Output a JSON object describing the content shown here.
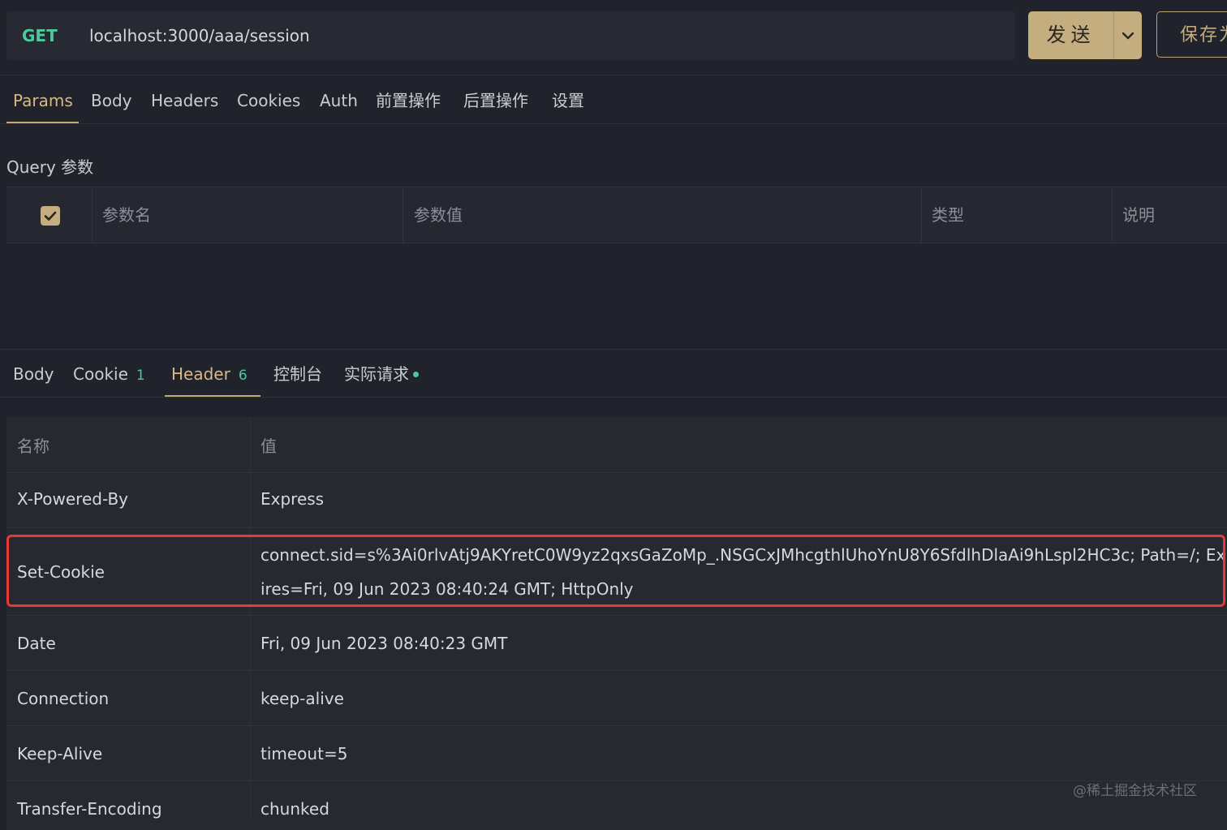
{
  "request": {
    "method": "GET",
    "url": "localhost:3000/aaa/session",
    "send_label": "发送",
    "save_label": "保存为"
  },
  "request_tabs": [
    {
      "label": "Params",
      "active": true
    },
    {
      "label": "Body"
    },
    {
      "label": "Headers"
    },
    {
      "label": "Cookies"
    },
    {
      "label": "Auth"
    },
    {
      "label": "前置操作"
    },
    {
      "label": "后置操作"
    },
    {
      "label": "设置"
    }
  ],
  "query": {
    "section_label": "Query 参数",
    "columns": [
      "参数名",
      "参数值",
      "类型",
      "说明"
    ],
    "all_checked": true
  },
  "response_tabs": [
    {
      "label": "Body"
    },
    {
      "label": "Cookie",
      "count": "1"
    },
    {
      "label": "Header",
      "count": "6",
      "active": true
    },
    {
      "label": "控制台"
    },
    {
      "label": "实际请求",
      "dot": true
    }
  ],
  "headers_table": {
    "columns": [
      "名称",
      "值"
    ],
    "rows": [
      {
        "name": "X-Powered-By",
        "value": "Express"
      },
      {
        "name": "Set-Cookie",
        "value_line1": "connect.sid=s%3Ai0rlvAtj9AKYretC0W9yz2qxsGaZoMp_.NSGCxJMhcgthlUhoYnU8Y6SfdlhDlaAi9hLspl2HC3c; Path=/; Exp",
        "value_line2": "ires=Fri, 09 Jun 2023 08:40:24 GMT; HttpOnly",
        "highlighted": true
      },
      {
        "name": "Date",
        "value": "Fri, 09 Jun 2023 08:40:23 GMT"
      },
      {
        "name": "Connection",
        "value": "keep-alive"
      },
      {
        "name": "Keep-Alive",
        "value": "timeout=5"
      },
      {
        "name": "Transfer-Encoding",
        "value": "chunked"
      }
    ]
  },
  "watermark": "@稀土掘金技术社区",
  "colors": {
    "background": "#20232b",
    "accent": "#c4ad7e",
    "method_green": "#4ec99b",
    "highlight_red": "#e63a32"
  }
}
